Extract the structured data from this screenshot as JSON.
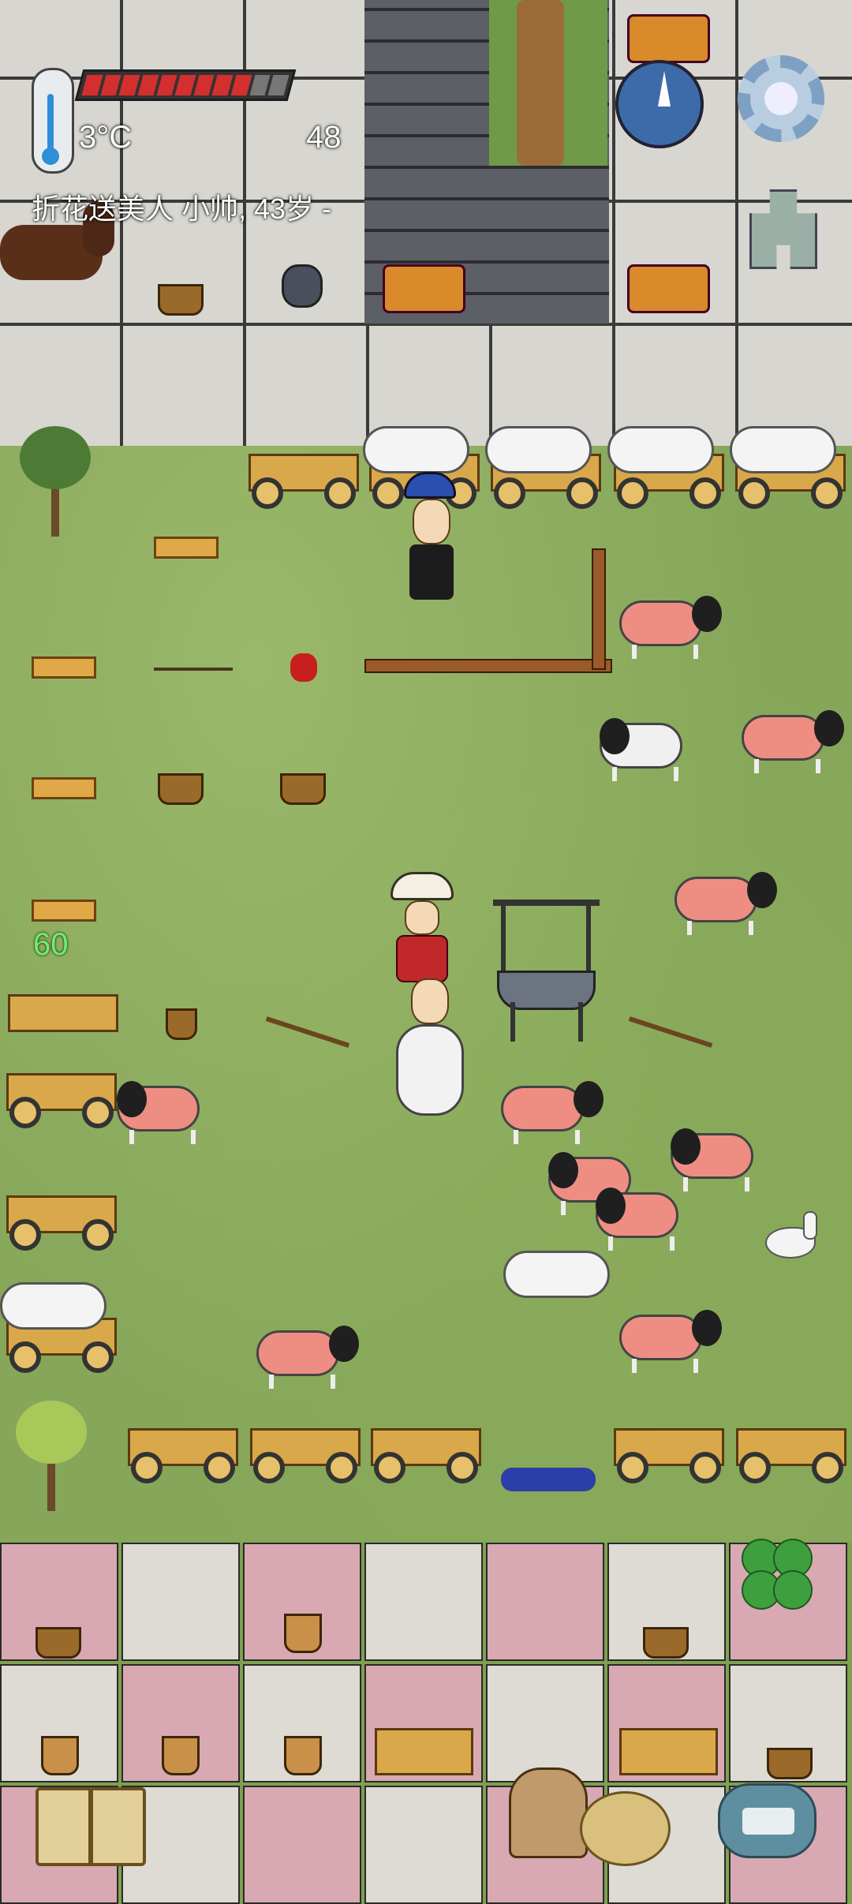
{
  "hud": {
    "temperature": "3°C",
    "food_value": "48",
    "food_pips_total": 11,
    "food_pips_filled": 9,
    "character_line": "折花送美人 小帅, 43岁 -",
    "floating_number": "60"
  },
  "icons": {
    "thermometer": "thermometer-icon",
    "compass": "compass-icon",
    "settings": "gear-icon",
    "coin": "ancient-coin-icon",
    "clover": "four-leaf-clover-icon",
    "book": "book-icon",
    "emote": "potato-emote-icon",
    "keyboard": "keyboard-chat-icon"
  },
  "colors": {
    "food_full": "#d32f2f",
    "food_empty": "#777777",
    "floating_number": "#6cf06c",
    "tile_pink": "#d8a9b3",
    "tile_white": "#dedbd5"
  }
}
